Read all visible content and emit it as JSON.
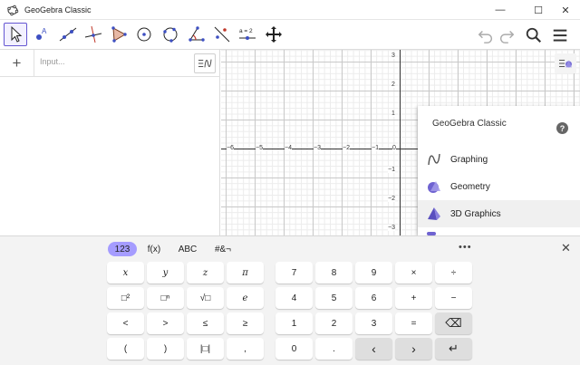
{
  "window": {
    "title": "GeoGebra Classic",
    "controls": {
      "minimize": "—",
      "maximize": "☐",
      "close": "✕"
    }
  },
  "toolbar": {
    "tools": [
      {
        "name": "move-tool-icon"
      },
      {
        "name": "point-tool-icon"
      },
      {
        "name": "line-tool-icon"
      },
      {
        "name": "perpendicular-line-tool-icon"
      },
      {
        "name": "polygon-tool-icon"
      },
      {
        "name": "circle-center-point-tool-icon"
      },
      {
        "name": "circle-three-points-tool-icon"
      },
      {
        "name": "angle-tool-icon"
      },
      {
        "name": "reflect-tool-icon"
      },
      {
        "name": "slider-tool-icon",
        "label": "a = 2"
      },
      {
        "name": "move-graphics-view-tool-icon"
      }
    ],
    "right": [
      "undo-icon",
      "redo-icon",
      "search-icon",
      "hamburger-menu-icon"
    ]
  },
  "algebra": {
    "add_symbol": "+",
    "input_placeholder": "Input..."
  },
  "graphics": {
    "x_ticks": [
      "−6",
      "−5",
      "−4",
      "−3",
      "−2",
      "−1",
      "0"
    ],
    "y_ticks_pos": [
      "3",
      "2",
      "1"
    ],
    "y_ticks_neg": [
      "−1",
      "−2",
      "−3"
    ]
  },
  "perspectives": {
    "title": "GeoGebra Classic",
    "help": "?",
    "items": [
      {
        "label": "Graphing",
        "icon": "graphing-icon"
      },
      {
        "label": "Geometry",
        "icon": "geometry-icon"
      },
      {
        "label": "3D Graphics",
        "icon": "3d-graphics-icon"
      }
    ]
  },
  "keyboard": {
    "tabs": [
      "123",
      "f(x)",
      "ABC",
      "#&¬"
    ],
    "more": "•••",
    "close": "✕",
    "left_keys": [
      [
        "x",
        "y",
        "z",
        "π"
      ],
      [
        "□²",
        "□ⁿ",
        "√□",
        "e"
      ],
      [
        "<",
        ">",
        "≤",
        "≥"
      ],
      [
        "(",
        ")",
        "|□|",
        ","
      ]
    ],
    "right_keys": [
      [
        "7",
        "8",
        "9",
        "×",
        "÷"
      ],
      [
        "4",
        "5",
        "6",
        "+",
        "−"
      ],
      [
        "1",
        "2",
        "3",
        "=",
        "⌫"
      ],
      [
        "0",
        ".",
        "‹",
        "›",
        "↵"
      ]
    ]
  }
}
